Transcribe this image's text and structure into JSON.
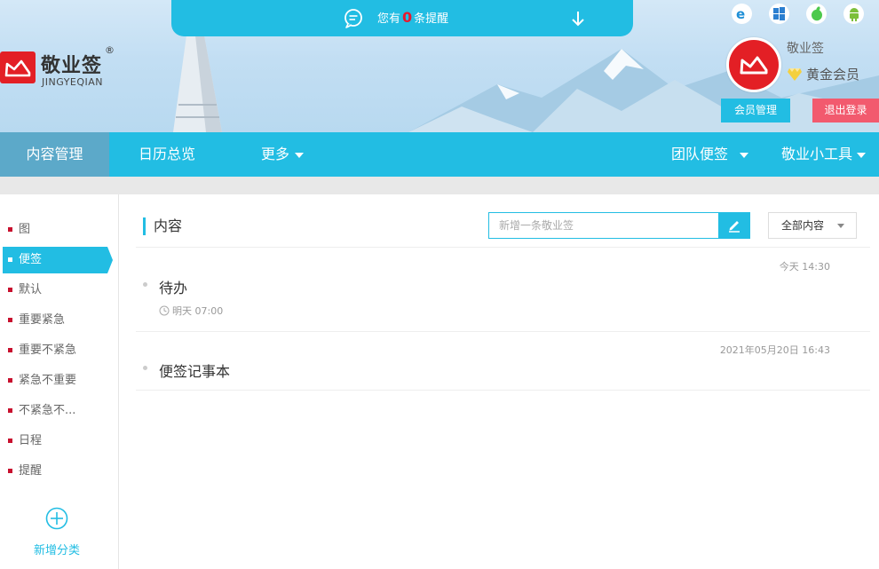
{
  "notice": {
    "prefix": "您有",
    "count": "0",
    "suffix": "条提醒"
  },
  "logo": {
    "name": "敬业签",
    "reg": "®",
    "pinyin": "JINGYEQIAN"
  },
  "platforms": [
    "ie-icon",
    "windows-icon",
    "apple-icon",
    "android-icon"
  ],
  "user": {
    "name": "敬业签",
    "level": "黄金会员",
    "member_btn": "会员管理",
    "logout_btn": "退出登录"
  },
  "nav": {
    "content": "内容管理",
    "calendar": "日历总览",
    "more": "更多",
    "team": "团队便签",
    "tools": "敬业小工具"
  },
  "sidebar": {
    "items": [
      {
        "label": "图"
      },
      {
        "label": "便签"
      },
      {
        "label": "默认"
      },
      {
        "label": "重要紧急"
      },
      {
        "label": "重要不紧急"
      },
      {
        "label": "紧急不重要"
      },
      {
        "label": "不紧急不..."
      },
      {
        "label": "日程"
      },
      {
        "label": "提醒"
      }
    ],
    "add_label": "新增分类"
  },
  "main": {
    "title": "内容",
    "search_placeholder": "新增一条敬业签",
    "filter": "全部内容",
    "notes": [
      {
        "time": "今天 14:30",
        "title": "待办",
        "remind": "明天 07:00"
      },
      {
        "time": "2021年05月20日 16:43",
        "title": "便签记事本"
      }
    ]
  },
  "colors": {
    "accent": "#22bde3",
    "brand_red": "#e31f25",
    "logout": "#f25a6e",
    "alert": "#e8182f"
  }
}
